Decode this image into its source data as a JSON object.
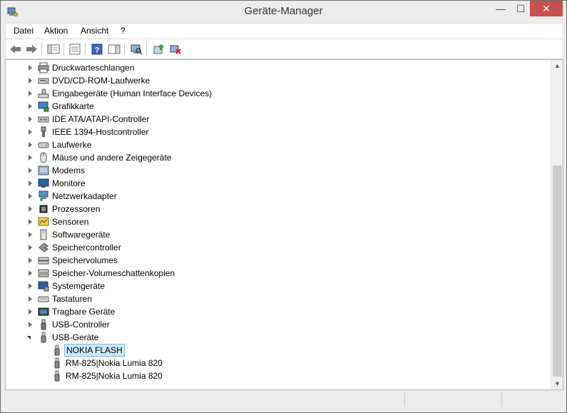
{
  "window": {
    "title": "Geräte-Manager",
    "minimize_label": "—",
    "maximize_label": "☐",
    "close_label": "✕"
  },
  "menu": [
    "Datei",
    "Aktion",
    "Ansicht",
    "?"
  ],
  "toolbar": {
    "buttons": [
      "back-arrow-icon",
      "forward-arrow-icon",
      "show-hide-console-tree-icon",
      "properties-icon",
      "help-icon",
      "action-pane-icon",
      "scan-hardware-icon",
      "update-driver-icon",
      "uninstall-device-icon"
    ]
  },
  "tree": {
    "items": [
      {
        "label": "Druckwarteschlangen",
        "expanded": false,
        "level": 0,
        "icon": "printer-icon"
      },
      {
        "label": "DVD/CD-ROM-Laufwerke",
        "expanded": false,
        "level": 0,
        "icon": "dvd-drive-icon"
      },
      {
        "label": "Eingabegeräte (Human Interface Devices)",
        "expanded": false,
        "level": 0,
        "icon": "hid-icon"
      },
      {
        "label": "Grafikkarte",
        "expanded": false,
        "level": 0,
        "icon": "display-adapter-icon"
      },
      {
        "label": "IDE ATA/ATAPI-Controller",
        "expanded": false,
        "level": 0,
        "icon": "ide-controller-icon"
      },
      {
        "label": "IEEE 1394-Hostcontroller",
        "expanded": false,
        "level": 0,
        "icon": "ieee1394-icon"
      },
      {
        "label": "Laufwerke",
        "expanded": false,
        "level": 0,
        "icon": "disk-drive-icon"
      },
      {
        "label": "Mäuse und andere Zeigegeräte",
        "expanded": false,
        "level": 0,
        "icon": "mouse-icon"
      },
      {
        "label": "Modems",
        "expanded": false,
        "level": 0,
        "icon": "modem-icon"
      },
      {
        "label": "Monitore",
        "expanded": false,
        "level": 0,
        "icon": "monitor-icon"
      },
      {
        "label": "Netzwerkadapter",
        "expanded": false,
        "level": 0,
        "icon": "network-adapter-icon"
      },
      {
        "label": "Prozessoren",
        "expanded": false,
        "level": 0,
        "icon": "processor-icon"
      },
      {
        "label": "Sensoren",
        "expanded": false,
        "level": 0,
        "icon": "sensor-icon"
      },
      {
        "label": "Softwaregeräte",
        "expanded": false,
        "level": 0,
        "icon": "software-device-icon"
      },
      {
        "label": "Speichercontroller",
        "expanded": false,
        "level": 0,
        "icon": "storage-controller-icon"
      },
      {
        "label": "Speichervolumes",
        "expanded": false,
        "level": 0,
        "icon": "storage-volume-icon"
      },
      {
        "label": "Speicher-Volumeschattenkopien",
        "expanded": false,
        "level": 0,
        "icon": "shadow-copy-icon"
      },
      {
        "label": "Systemgeräte",
        "expanded": false,
        "level": 0,
        "icon": "system-device-icon"
      },
      {
        "label": "Tastaturen",
        "expanded": false,
        "level": 0,
        "icon": "keyboard-icon"
      },
      {
        "label": "Tragbare Geräte",
        "expanded": false,
        "level": 0,
        "icon": "portable-device-icon"
      },
      {
        "label": "USB-Controller",
        "expanded": false,
        "level": 0,
        "icon": "usb-controller-icon"
      },
      {
        "label": "USB-Geräte",
        "expanded": true,
        "level": 0,
        "icon": "usb-device-icon"
      },
      {
        "label": "NOKIA FLASH",
        "level": 1,
        "icon": "usb-device-icon",
        "selected": true
      },
      {
        "label": "RM-825|Nokia Lumia 820",
        "level": 1,
        "icon": "usb-device-icon"
      },
      {
        "label": "RM-825|Nokia Lumia 820",
        "level": 1,
        "icon": "usb-device-icon"
      }
    ]
  }
}
